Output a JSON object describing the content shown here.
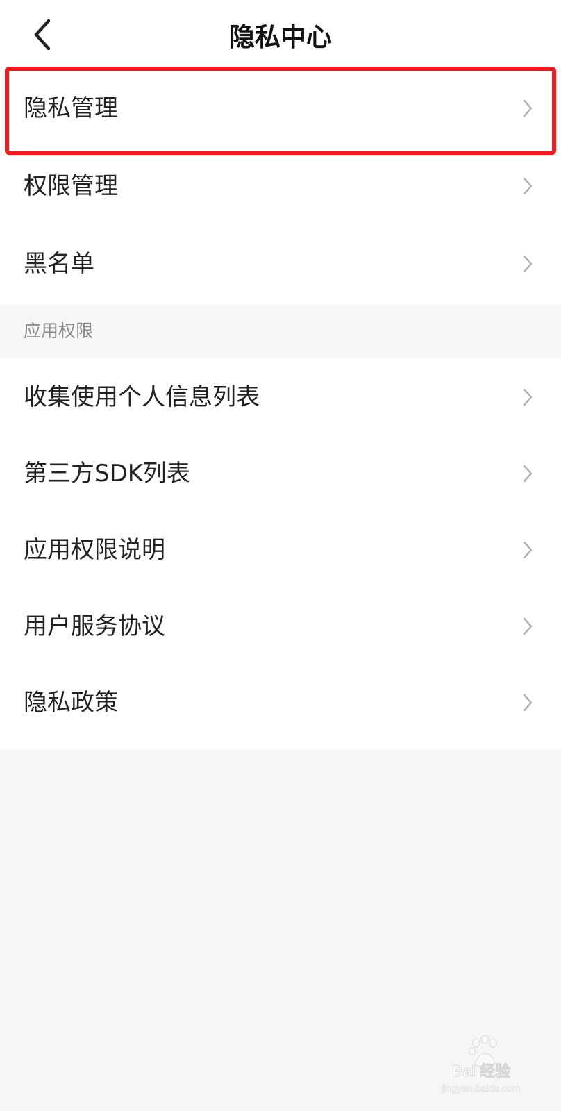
{
  "header": {
    "title": "隐私中心",
    "back_icon": "chevron-left-icon"
  },
  "menu_group_1": [
    {
      "label": "隐私管理",
      "icon": "chevron-right-icon",
      "highlighted": true
    },
    {
      "label": "权限管理",
      "icon": "chevron-right-icon"
    },
    {
      "label": "黑名单",
      "icon": "chevron-right-icon"
    }
  ],
  "section": {
    "label": "应用权限"
  },
  "menu_group_2": [
    {
      "label": "收集使用个人信息列表",
      "icon": "chevron-right-icon"
    },
    {
      "label": "第三方SDK列表",
      "icon": "chevron-right-icon"
    },
    {
      "label": "应用权限说明",
      "icon": "chevron-right-icon"
    },
    {
      "label": "用户服务协议",
      "icon": "chevron-right-icon"
    },
    {
      "label": "隐私政策",
      "icon": "chevron-right-icon"
    }
  ],
  "watermark": {
    "brand": "Baidu经验",
    "url": "jingyan.baidu.com"
  },
  "colors": {
    "highlight": "#ee1c1c",
    "background": "#f6f6f6",
    "surface": "#ffffff",
    "text": "#222222",
    "muted_text": "#8a8a8a",
    "chevron": "#b0b0b0"
  }
}
